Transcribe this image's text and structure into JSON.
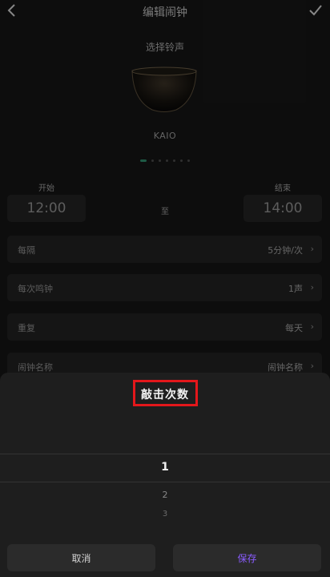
{
  "header": {
    "title": "编辑闹钟"
  },
  "sound": {
    "section_label": "选择铃声",
    "name": "KAIO"
  },
  "time": {
    "start_label": "开始",
    "end_label": "结束",
    "start_value": "12:00",
    "end_value": "14:00",
    "separator": "至"
  },
  "settings": [
    {
      "label": "每隔",
      "value": "5分钟/次"
    },
    {
      "label": "每次鸣钟",
      "value": "1声"
    },
    {
      "label": "重复",
      "value": "每天"
    },
    {
      "label": "闹钟名称",
      "value": "闹钟名称"
    }
  ],
  "sheet": {
    "title": "敲击次数",
    "options": [
      "1",
      "2",
      "3"
    ],
    "selected": "1",
    "cancel_label": "取消",
    "save_label": "保存"
  },
  "colors": {
    "accent": "#8a5cff",
    "highlight": "#e3171b",
    "page_indicator": "#2e8a6a"
  }
}
